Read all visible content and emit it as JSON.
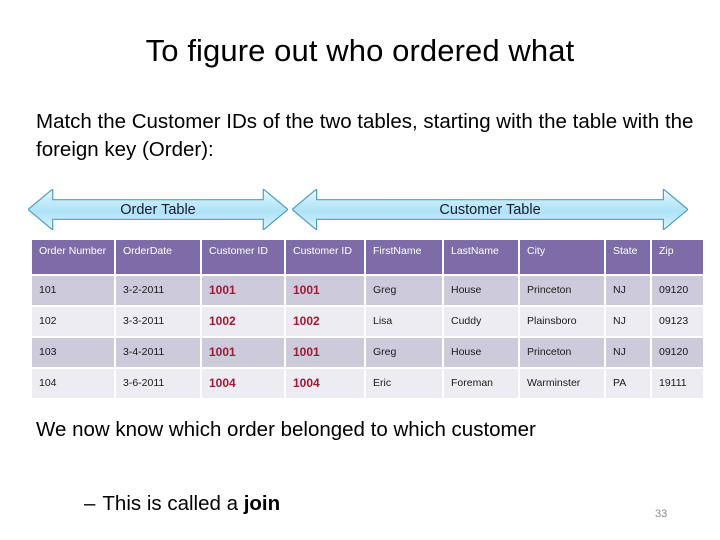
{
  "slide": {
    "title": "To figure out who ordered what",
    "intro": "Match the Customer IDs of the two tables, starting with the table with the foreign key (Order):",
    "conclusion": "We now know which order belonged to which customer",
    "conclusion_dash": "–",
    "conclusion_sub_prefix": "This is called a ",
    "conclusion_keyword": "join",
    "page_number": "33"
  },
  "banners": [
    {
      "label": "Order Table",
      "name": "order-table-banner"
    },
    {
      "label": "Customer Table",
      "name": "customer-table-banner"
    }
  ],
  "table": {
    "headers": [
      "Order Number",
      "OrderDate",
      "Customer ID",
      "Customer ID",
      "FirstName",
      "LastName",
      "City",
      "State",
      "Zip"
    ],
    "rows": [
      {
        "order_number": "101",
        "order_date": "3-2-2011",
        "customer_id_order": "1001",
        "customer_id_customer": "1001",
        "first_name": "Greg",
        "last_name": "House",
        "city": "Princeton",
        "state": "NJ",
        "zip": "09120"
      },
      {
        "order_number": "102",
        "order_date": "3-3-2011",
        "customer_id_order": "1002",
        "customer_id_customer": "1002",
        "first_name": "Lisa",
        "last_name": "Cuddy",
        "city": "Plainsboro",
        "state": "NJ",
        "zip": "09123"
      },
      {
        "order_number": "103",
        "order_date": "3-4-2011",
        "customer_id_order": "1001",
        "customer_id_customer": "1001",
        "first_name": "Greg",
        "last_name": "House",
        "city": "Princeton",
        "state": "NJ",
        "zip": "09120"
      },
      {
        "order_number": "104",
        "order_date": "3-6-2011",
        "customer_id_order": "1004",
        "customer_id_customer": "1004",
        "first_name": "Eric",
        "last_name": "Foreman",
        "city": "Warminster",
        "state": "PA",
        "zip": "19111"
      }
    ]
  },
  "colors": {
    "header_purple": "#7d6ca8",
    "row_odd": "#cdcadc",
    "row_even": "#edecf2",
    "highlight_text": "#9e1b33",
    "arrow_fill": "#aee3f7",
    "arrow_outline": "#4f9fc0",
    "page_number": "#8c8c8c"
  }
}
